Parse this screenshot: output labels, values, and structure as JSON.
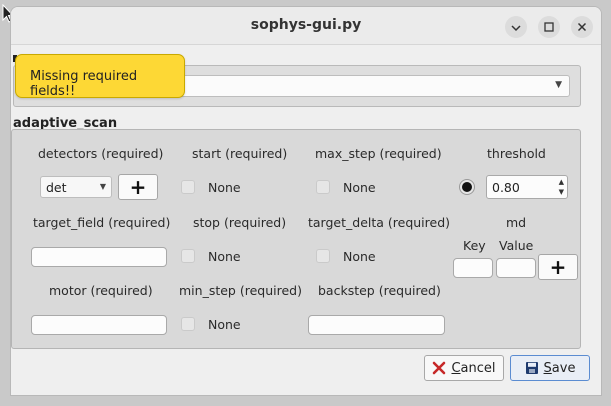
{
  "window": {
    "title": "sophys-gui.py",
    "minimize": "⌄",
    "maximize": "☐",
    "close": "✕"
  },
  "tooltip": {
    "text": "Missing required fields!!"
  },
  "group": {
    "title": "adaptive_scan"
  },
  "fields": {
    "detectors": {
      "label": "detectors (required)",
      "selected": "det",
      "add": "+"
    },
    "start": {
      "label": "start (required)",
      "value": "None"
    },
    "max_step": {
      "label": "max_step (required)",
      "value": "None"
    },
    "threshold": {
      "label": "threshold",
      "value": "0.80"
    },
    "target_field": {
      "label": "target_field (required)",
      "value": ""
    },
    "stop": {
      "label": "stop (required)",
      "value": "None"
    },
    "target_delta": {
      "label": "target_delta (required)",
      "value": "None"
    },
    "md": {
      "label": "md",
      "key_label": "Key",
      "value_label": "Value",
      "add": "+"
    },
    "motor": {
      "label": "motor (required)",
      "value": ""
    },
    "min_step": {
      "label": "min_step (required)",
      "value": "None"
    },
    "backstep": {
      "label": "backstep (required)",
      "value": ""
    }
  },
  "footer": {
    "cancel_prefix": "",
    "cancel_mnemonic": "C",
    "cancel_rest": "ancel",
    "save_mnemonic": "S",
    "save_rest": "ave"
  }
}
